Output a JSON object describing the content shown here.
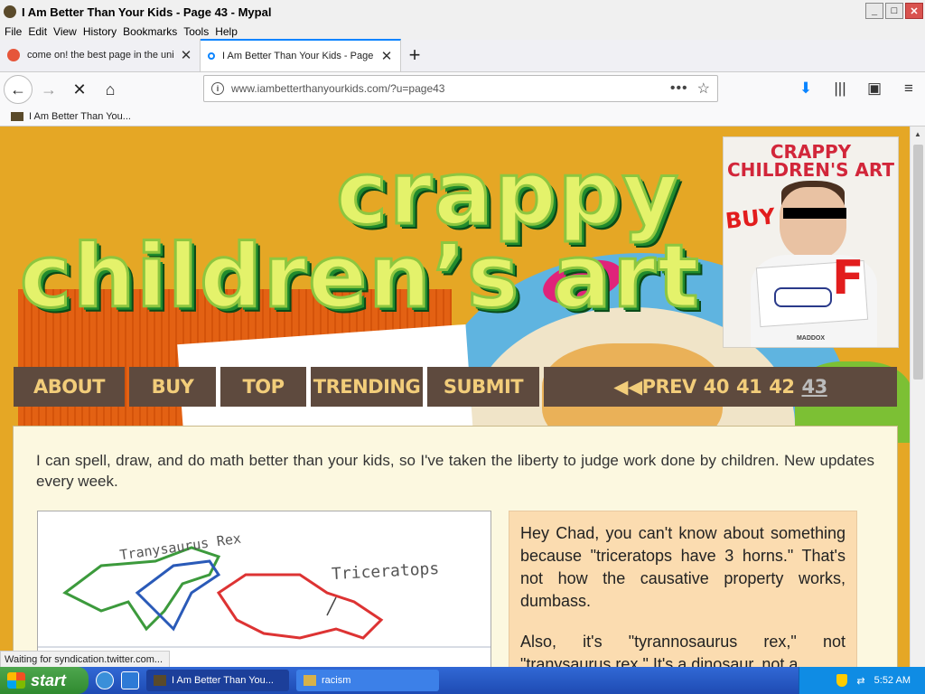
{
  "window": {
    "title": "I Am Better Than Your Kids - Page 43 - Mypal"
  },
  "menu": [
    "File",
    "Edit",
    "View",
    "History",
    "Bookmarks",
    "Tools",
    "Help"
  ],
  "tabs": [
    {
      "label": "come on! the best page in the uni",
      "active": false
    },
    {
      "label": "I Am Better Than Your Kids - Page",
      "active": true
    }
  ],
  "url": "www.iambetterthanyourkids.com/?u=page43",
  "bookmark": {
    "label": "I Am Better Than You..."
  },
  "site": {
    "logo_line1": "crappy",
    "logo_line2": "children’s art",
    "book": {
      "title": "CRAPPY CHILDREN'S ART",
      "buy": "BUY",
      "grade": "F",
      "author": "MADDOX"
    },
    "nav": [
      "ABOUT",
      "BUY",
      "TOP",
      "TRENDING",
      "SUBMIT"
    ],
    "pager": {
      "prefix": "◀◀PREV",
      "pages": [
        "40",
        "41",
        "42"
      ],
      "current": "43"
    },
    "intro": "I can spell, draw, and do math better than your kids, so I've taken the liberty to judge work done by children. New updates every week.",
    "drawing_labels": [
      "Tranysaurus Rex",
      "Triceratops"
    ],
    "comment": [
      "Hey Chad, you can't know about something because \"triceratops have 3 horns.\" That's not how the causative property works, dumbass.",
      "Also, it's \"tyrannosaurus rex,\" not \"tranysaurus rex.\" It's a dinosaur, not a"
    ]
  },
  "status": "Waiting for syndication.twitter.com...",
  "taskbar": {
    "start": "start",
    "items": [
      "I Am Better Than You...",
      "racism"
    ],
    "clock": "5:52 AM"
  }
}
